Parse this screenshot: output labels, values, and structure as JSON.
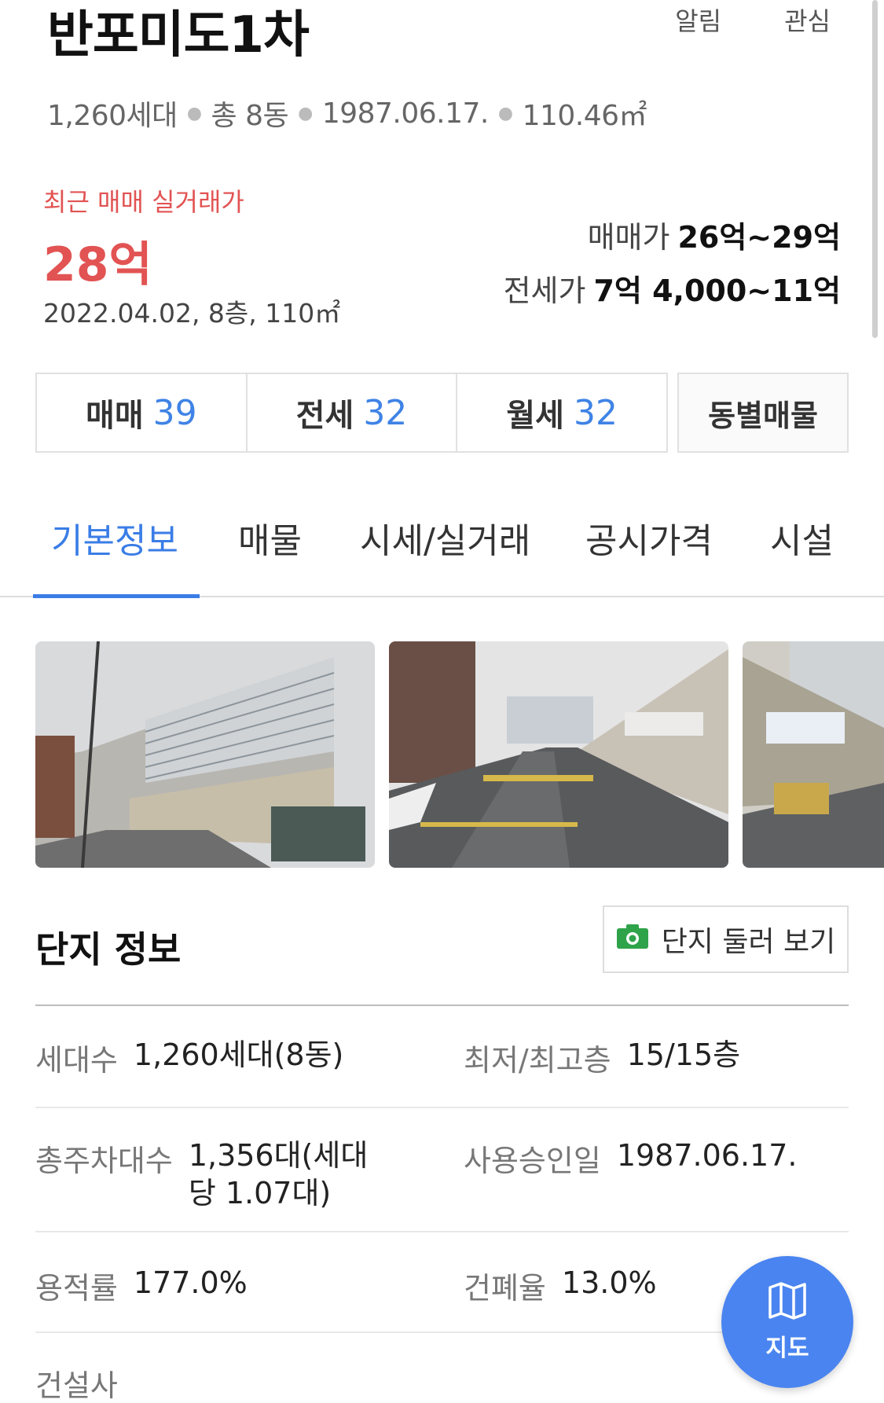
{
  "header": {
    "title": "반포미도1차",
    "alert_label": "알림",
    "favorite_label": "관심"
  },
  "summary": {
    "households": "1,260세대",
    "buildings": "총 8동",
    "approval_date": "1987.06.17.",
    "area": "110.46㎡"
  },
  "recent_trade": {
    "label": "최근 매매 실거래가",
    "price": "28억",
    "meta": "2022.04.02, 8층, 110㎡"
  },
  "price_range": {
    "sale_label": "매매가",
    "sale_value": "26억~29억",
    "jeonse_label": "전세가",
    "jeonse_value": "7억 4,000~11억"
  },
  "counts": [
    {
      "label": "매매",
      "num": "39"
    },
    {
      "label": "전세",
      "num": "32"
    },
    {
      "label": "월세",
      "num": "32"
    }
  ],
  "dong_button": "동별매물",
  "tabs": [
    "기본정보",
    "매물",
    "시세/실거래",
    "공시가격",
    "시설"
  ],
  "section": {
    "title": "단지 정보",
    "tour_button": "단지 둘러 보기"
  },
  "info": {
    "households_k": "세대수",
    "households_v": "1,260세대(8동)",
    "floors_k": "최저/최고층",
    "floors_v": "15/15층",
    "parking_k": "총주차대수",
    "parking_v": "1,356대(세대당 1.07대)",
    "approval_k": "사용승인일",
    "approval_v": "1987.06.17.",
    "far_k": "용적률",
    "far_v": "177.0%",
    "bcr_k": "건폐율",
    "bcr_v": "13.0%",
    "builder_k": "건설사"
  },
  "map_button": "지도",
  "colors": {
    "accent_blue": "#3a7de6",
    "price_red": "#e25353",
    "fab_blue": "#4a84f0"
  }
}
